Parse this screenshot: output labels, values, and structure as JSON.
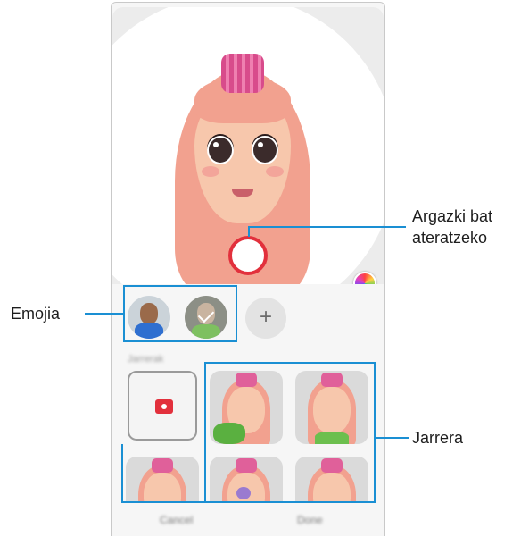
{
  "callouts": {
    "shutter_line1": "Argazki bat",
    "shutter_line2": "ateratzeko",
    "emoji": "Emojia",
    "action": "Jarrera"
  },
  "emoji_row": {
    "add_label": "+"
  },
  "section": {
    "label": "Jarrerak"
  },
  "bottom_bar": {
    "cancel_label": "Cancel",
    "done_label": "Done"
  },
  "colors": {
    "callout": "#1a8fd3",
    "shutter_ring": "#e2303c",
    "hair": "#f2a18f",
    "skin": "#f7c7ac"
  }
}
